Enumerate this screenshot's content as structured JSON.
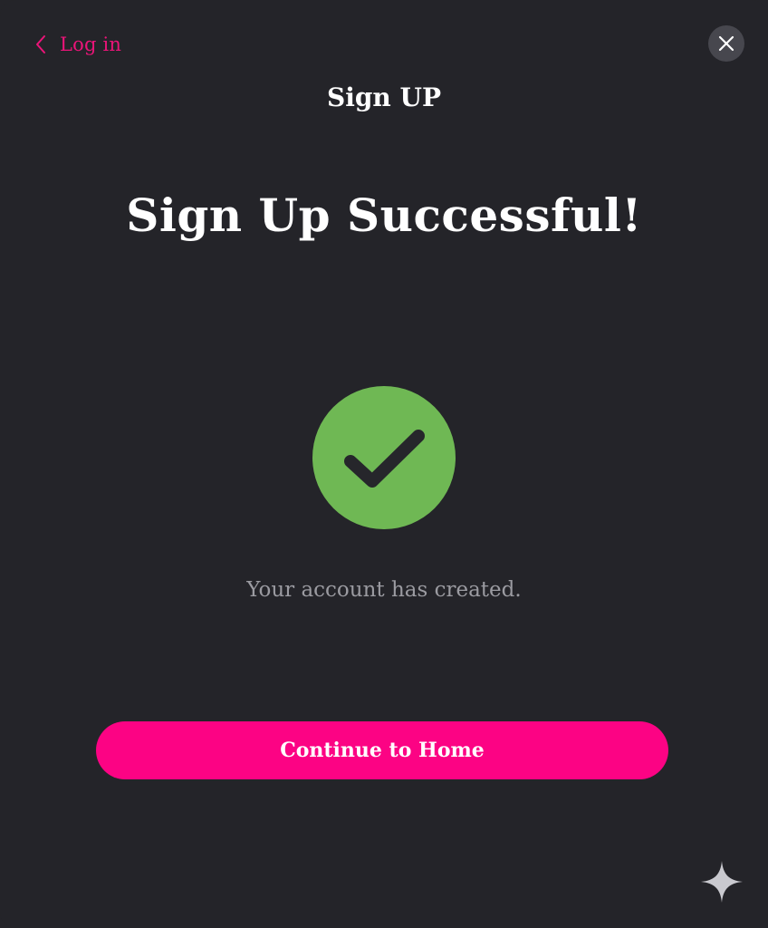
{
  "navigation": {
    "back_label": "Log in"
  },
  "header": {
    "title": "Sign UP"
  },
  "main": {
    "headline": "Sign Up Successful!",
    "status_icon": "check-circle-icon",
    "message": "Your account has created."
  },
  "actions": {
    "continue_label": "Continue to Home"
  },
  "icons": {
    "back": "chevron-left-icon",
    "close": "close-icon",
    "corner": "sparkle-icon"
  },
  "colors": {
    "background": "#242429",
    "accent": "#ec1479",
    "button": "#fc0384",
    "success": "#6fb854",
    "close_bg": "#47474e",
    "muted_text": "#9b9ba1"
  }
}
